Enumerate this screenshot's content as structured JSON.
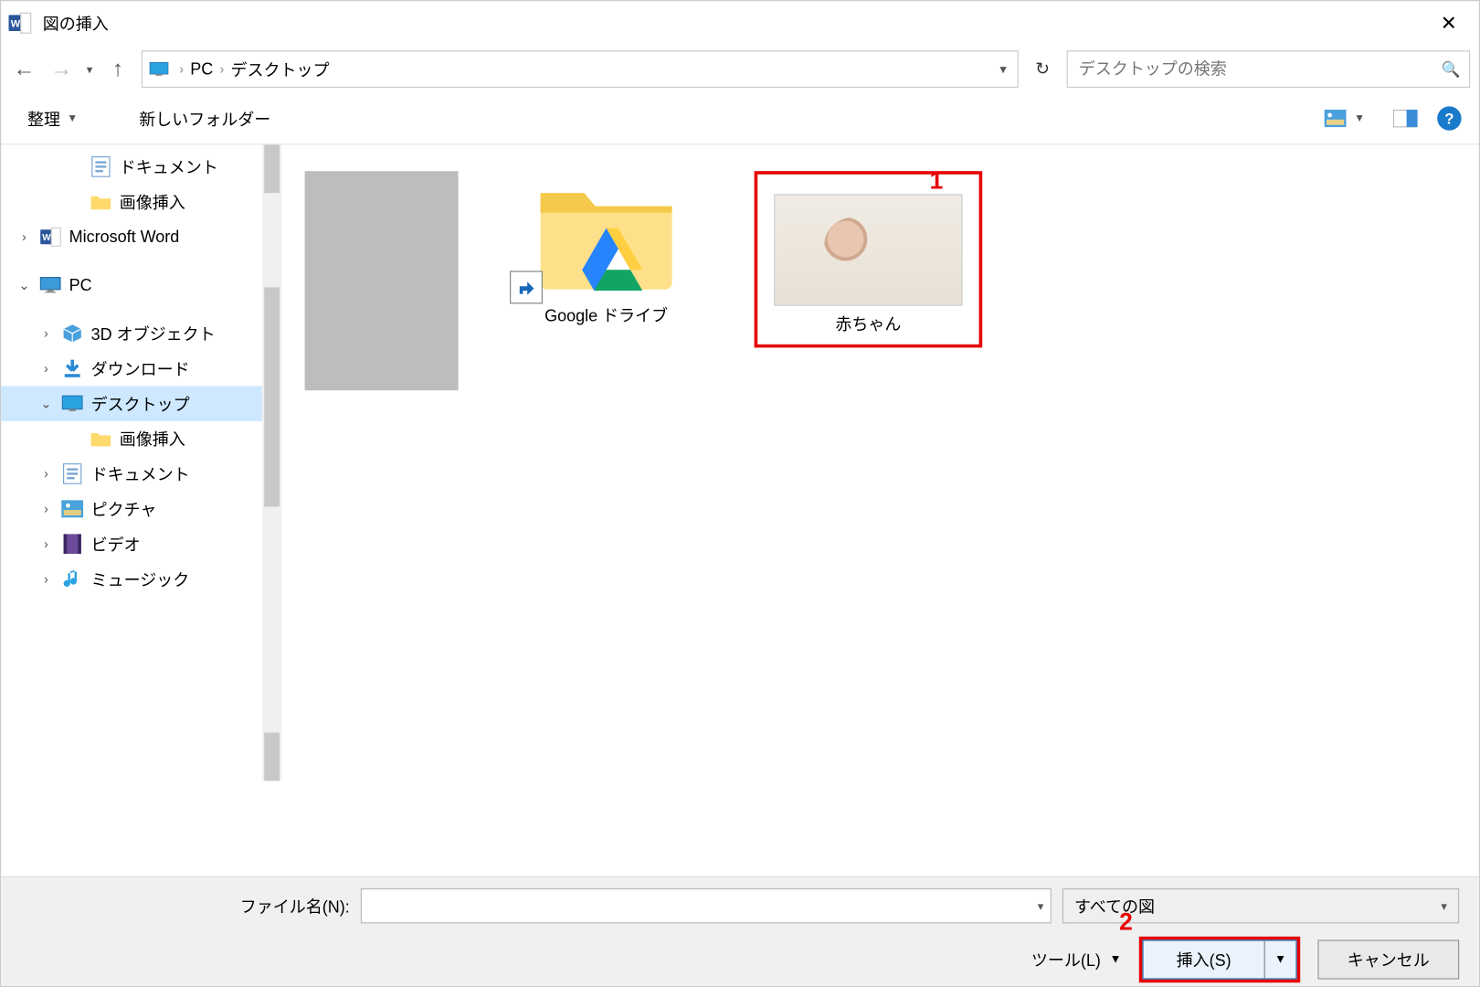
{
  "window": {
    "title": "図の挿入"
  },
  "nav": {
    "breadcrumb": [
      "PC",
      "デスクトップ"
    ],
    "search_placeholder": "デスクトップの検索"
  },
  "toolbar": {
    "organize": "整理",
    "new_folder": "新しいフォルダー"
  },
  "tree": {
    "items": [
      {
        "label": "ドキュメント",
        "icon": "doc",
        "indent": 3,
        "chev": "none"
      },
      {
        "label": "画像挿入",
        "icon": "folder",
        "indent": 3,
        "chev": "none"
      },
      {
        "label": "Microsoft Word",
        "icon": "word",
        "indent": 1,
        "chev": "right"
      },
      {
        "label": "PC",
        "icon": "pc",
        "indent": 1,
        "chev": "down"
      },
      {
        "label": "3D オブジェクト",
        "icon": "3d",
        "indent": 2,
        "chev": "right"
      },
      {
        "label": "ダウンロード",
        "icon": "download",
        "indent": 2,
        "chev": "right"
      },
      {
        "label": "デスクトップ",
        "icon": "desktop",
        "indent": 2,
        "chev": "down",
        "selected": true
      },
      {
        "label": "画像挿入",
        "icon": "folder",
        "indent": 3,
        "chev": "none"
      },
      {
        "label": "ドキュメント",
        "icon": "doc",
        "indent": 2,
        "chev": "right"
      },
      {
        "label": "ピクチャ",
        "icon": "pictures",
        "indent": 2,
        "chev": "right"
      },
      {
        "label": "ビデオ",
        "icon": "video",
        "indent": 2,
        "chev": "right"
      },
      {
        "label": "ミュージック",
        "icon": "music",
        "indent": 2,
        "chev": "right"
      }
    ]
  },
  "content": {
    "items": [
      {
        "type": "folder",
        "label": "Google ドライブ"
      },
      {
        "type": "image",
        "label": "赤ちゃん"
      }
    ]
  },
  "callouts": {
    "one": "1",
    "two": "2"
  },
  "bottom": {
    "filename_label": "ファイル名(N):",
    "filetype_value": "すべての図",
    "tools_label": "ツール(L)",
    "insert_label": "挿入(S)",
    "cancel_label": "キャンセル"
  }
}
